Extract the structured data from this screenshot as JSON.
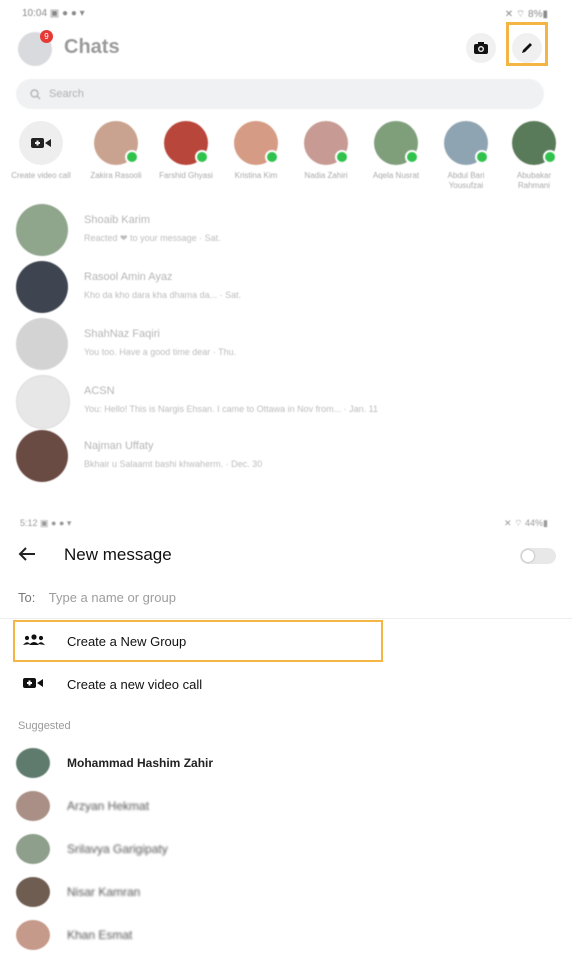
{
  "chats_screen": {
    "status_left": "10:04 ▣ ● ● ▾",
    "status_right": "✕ ⌔ 8%▮",
    "badge_count": "9",
    "title": "Chats",
    "search_placeholder": "Search",
    "create_video_call": "Create video call",
    "stories": [
      {
        "name": "Zakira Rasooli",
        "color": "#c9a38f"
      },
      {
        "name": "Farshid Ghyasi",
        "color": "#b9463b"
      },
      {
        "name": "Kristina Kim",
        "color": "#d69b84"
      },
      {
        "name": "Nadia Zahiri",
        "color": "#c79b94"
      },
      {
        "name": "Aqela Nusrat",
        "color": "#7f9f7b"
      },
      {
        "name": "Abdul Bari Yousufzai",
        "color": "#8fa4b2"
      },
      {
        "name": "Abubakar Rahmani",
        "color": "#5a7b5a"
      }
    ],
    "chats": [
      {
        "name": "Shoaib Karim",
        "message": "Reacted ❤ to your message · Sat.",
        "color": "#8fa68c"
      },
      {
        "name": "Rasool Amin Ayaz",
        "message": "Kho da kho dara kha dhama da... · Sat.",
        "color": "#3f4550"
      },
      {
        "name": "ShahNaz Faqiri",
        "message": "You too. Have a good time dear · Thu.",
        "color": "#d3d3d3"
      },
      {
        "name": "ACSN",
        "message": "You: Hello! This is Nargis Ehsan. I came to Ottawa in Nov from... · Jan. 11",
        "color": "#e7e7e7"
      },
      {
        "name": "Najman Uffaty",
        "message": "Bkhair u Salaamt bashi khwaherm. · Dec. 30",
        "color": "#6a4b43"
      }
    ]
  },
  "new_message_screen": {
    "status_left": "5:12 ▣ ● ● ▾",
    "status_right": "✕ ⌔ 44%▮",
    "title": "New message",
    "to_label": "To:",
    "to_placeholder": "Type a name or group",
    "create_group_label": "Create a New Group",
    "create_video_label": "Create a new video call",
    "suggested_label": "Suggested",
    "suggested": [
      {
        "name": "Mohammad Hashim Zahir",
        "color": "#5f7b6e"
      },
      {
        "name": "Arzyan Hekmat",
        "color": "#a98f85"
      },
      {
        "name": "Srilavya Garigipaty",
        "color": "#8e9f8b"
      },
      {
        "name": "Nisar Kamran",
        "color": "#6f5d52"
      },
      {
        "name": "Khan Esmat",
        "color": "#c69a8a"
      }
    ]
  },
  "colors": {
    "highlight": "#f5b544",
    "online": "#31c24d"
  }
}
